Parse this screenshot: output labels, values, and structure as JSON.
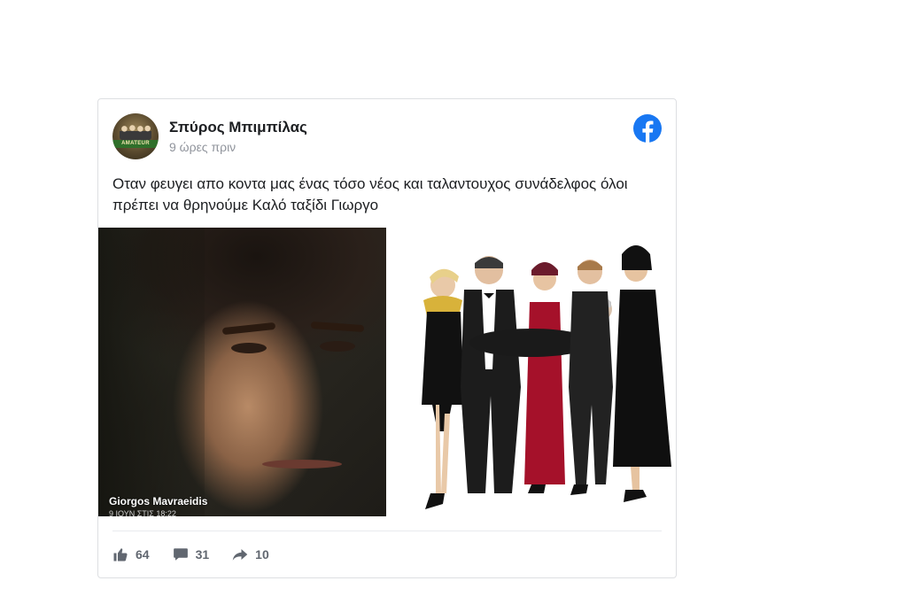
{
  "post": {
    "author": "Σπύρος Μπιμπίλας",
    "time": "9 ώρες πριν",
    "avatar_label": "AMATEUR",
    "text": "Οταν φευγει απο κοντα μας ένας τόσο νέος και ταλαντουχος συνάδελφος όλοι πρέπει να θρηνούμε Καλό ταξίδι Γιωργο",
    "photo_caption": "Giorgos Mavraeidis",
    "photo_caption_sub": "9 ΙΟΥΝ ΣΤΙΣ 18:22"
  },
  "icons": {
    "platform": "facebook-icon",
    "like": "thumbs-up-icon",
    "comment": "comment-icon",
    "share": "share-arrow-icon"
  },
  "actions": {
    "likes": "64",
    "comments": "31",
    "shares": "10"
  },
  "colors": {
    "facebook_blue": "#1877f2",
    "action_gray": "#616770",
    "border": "#dddfe2"
  }
}
